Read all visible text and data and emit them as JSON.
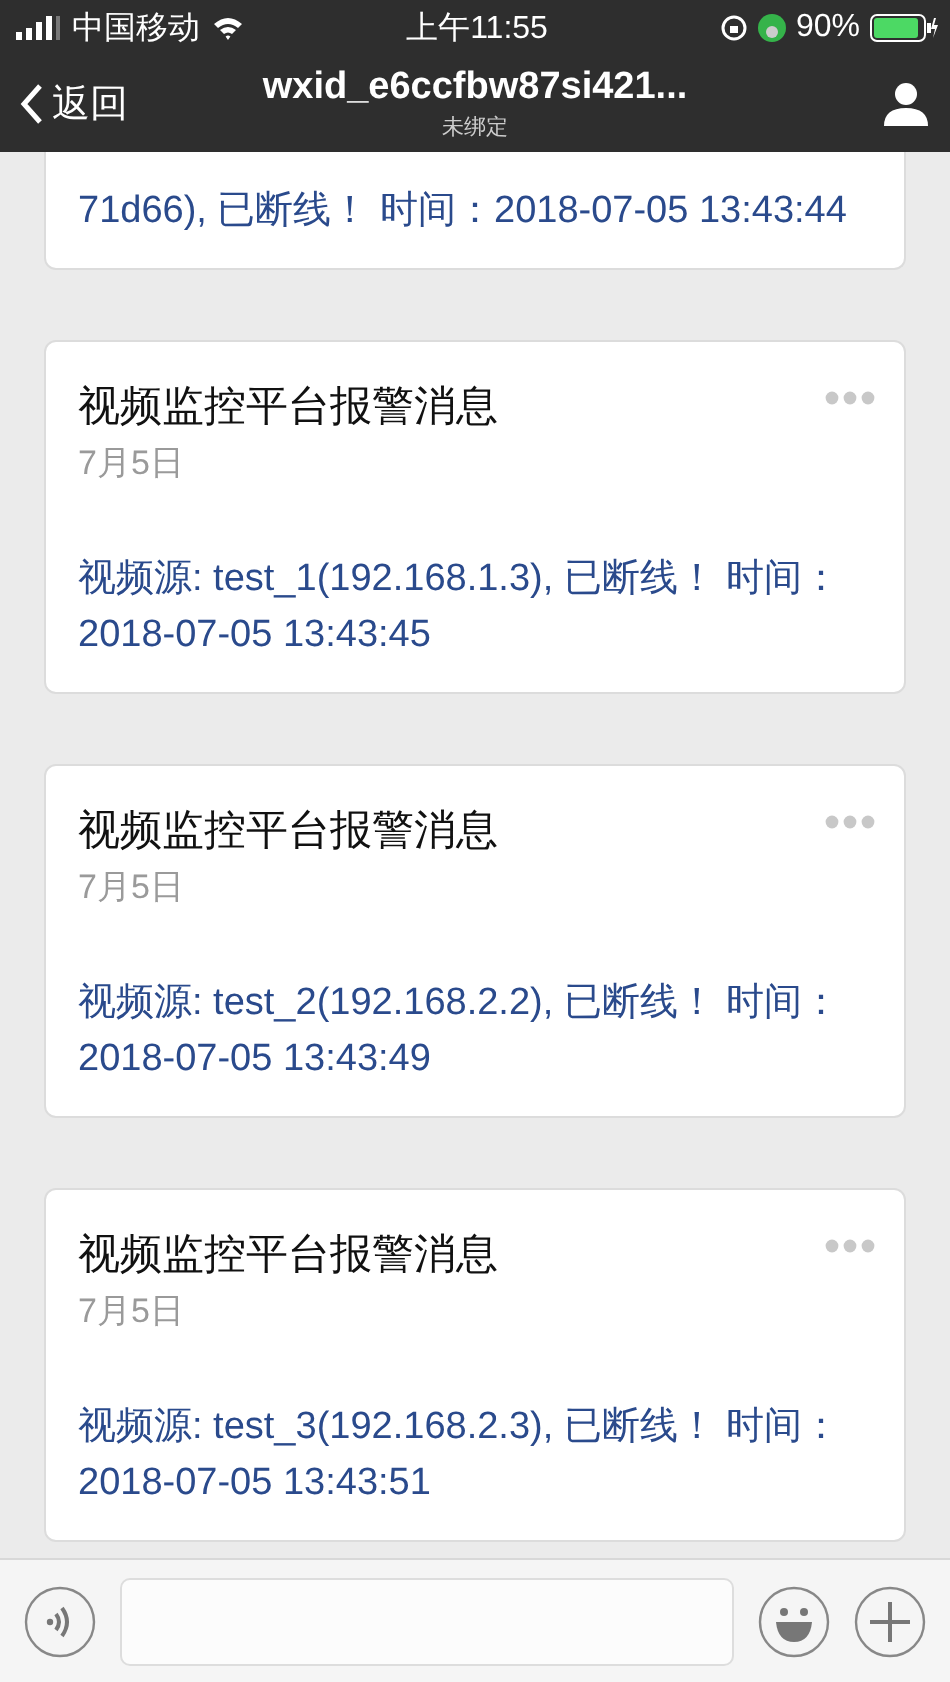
{
  "status_bar": {
    "carrier": "中国移动",
    "time": "上午11:55",
    "battery_percent": "90%"
  },
  "nav_bar": {
    "back_label": "返回",
    "title": "wxid_e6ccfbw87si421...",
    "subtitle": "未绑定"
  },
  "messages": [
    {
      "kind": "partial",
      "body": "71d66), 已断线！ 时间：2018-07-05 13:43:44"
    },
    {
      "kind": "card",
      "title": "视频监控平台报警消息",
      "date": "7月5日",
      "body": "视频源: test_1(192.168.1.3), 已断线！ 时间：2018-07-05 13:43:45"
    },
    {
      "kind": "card",
      "title": "视频监控平台报警消息",
      "date": "7月5日",
      "body": "视频源: test_2(192.168.2.2), 已断线！ 时间：2018-07-05 13:43:49"
    },
    {
      "kind": "card",
      "title": "视频监控平台报警消息",
      "date": "7月5日",
      "body": "视频源: test_3(192.168.2.3), 已断线！ 时间：2018-07-05 13:43:51"
    }
  ]
}
